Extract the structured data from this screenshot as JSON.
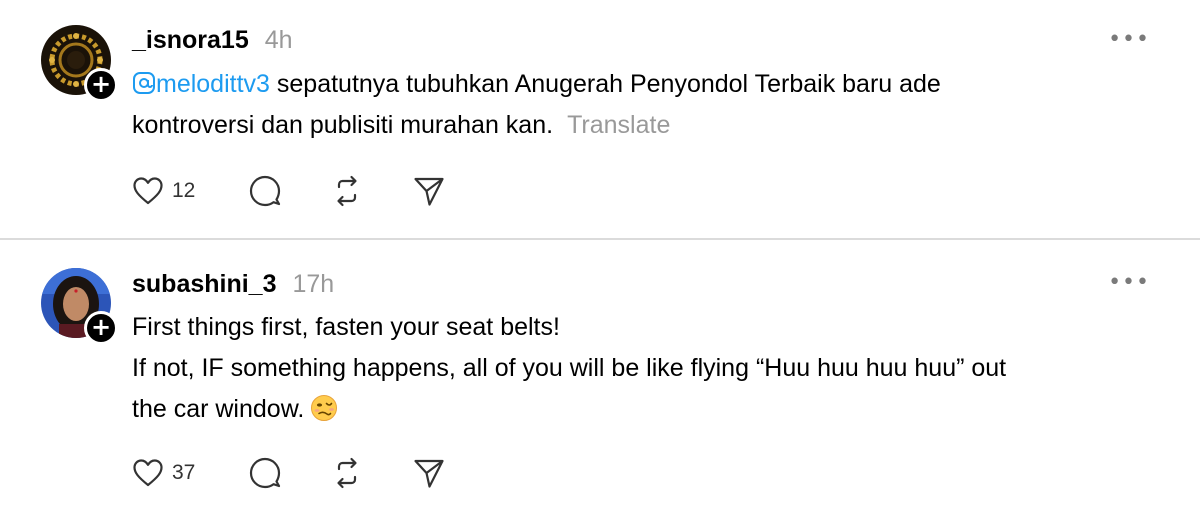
{
  "posts": [
    {
      "username": "_isnora15",
      "time": "4h",
      "mention": "melodittv3",
      "text_line_1": " sepatutnya tubuhkan Anugerah Penyondol Terbaik baru ade",
      "text_line_2": "kontroversi dan publisiti murahan kan.",
      "translate_label": "Translate",
      "likes": "12",
      "follow_symbol": "+",
      "more_label": "•••"
    },
    {
      "username": "subashini_3",
      "time": "17h",
      "text_line_1": "First things first, fasten your seat belts!",
      "text_line_2": "If not, IF something happens, all of you will be like flying “Huu huu huu huu” out",
      "text_line_3": "the car window.",
      "likes": "37",
      "follow_symbol": "+",
      "more_label": "•••"
    }
  ],
  "icons": {
    "like": "heart-icon",
    "comment": "comment-icon",
    "repost": "repost-icon",
    "share": "send-icon",
    "mention": "at-icon",
    "emoji": "woozy-face-emoji"
  },
  "colors": {
    "mention": "#1d9bf0",
    "muted": "#999999",
    "divider": "#dbdbdb"
  }
}
